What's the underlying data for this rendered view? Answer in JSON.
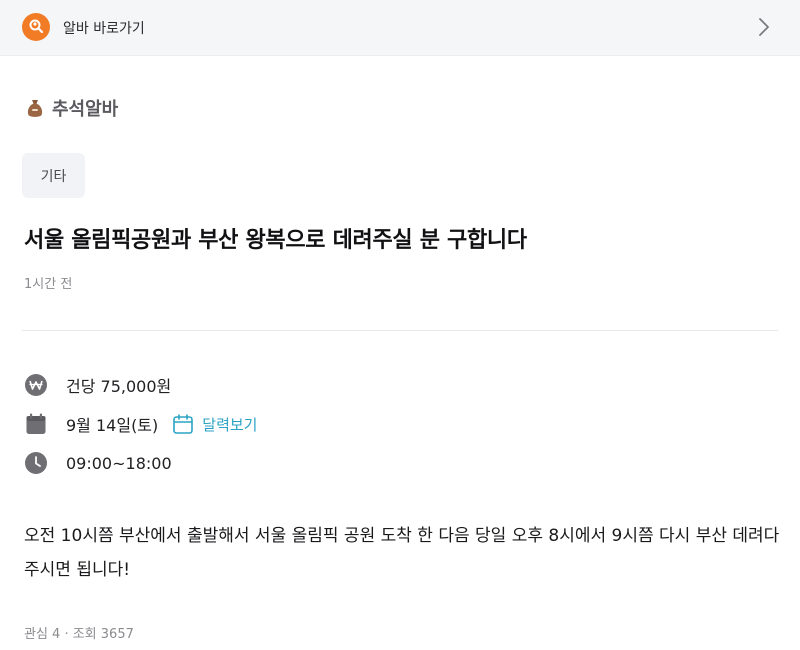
{
  "topbar": {
    "title": "알바 바로가기",
    "logo_icon": "search-person-icon",
    "chevron_icon": "chevron-right-icon",
    "accent": "#f27b26"
  },
  "category": {
    "icon": "money-bag-icon",
    "label": "추석알바"
  },
  "tag": "기타",
  "post": {
    "title": "서울 올림픽공원과 부산 왕복으로 데려주실 분 구합니다",
    "time": "1시간 전"
  },
  "info": {
    "wage": "건당 75,000원",
    "date": "9월 14일(토)",
    "calendar_link": "달력보기",
    "hours": "09:00~18:00",
    "link_color": "#2ba3c4"
  },
  "body": "오전 10시쯤 부산에서 출발해서 서울 올림픽 공원 도착 한 다음 당일 오후 8시에서 9시쯤 다시 부산 데려다 주시면 됩니다!",
  "stats": "관심 4 · 조회 3657"
}
